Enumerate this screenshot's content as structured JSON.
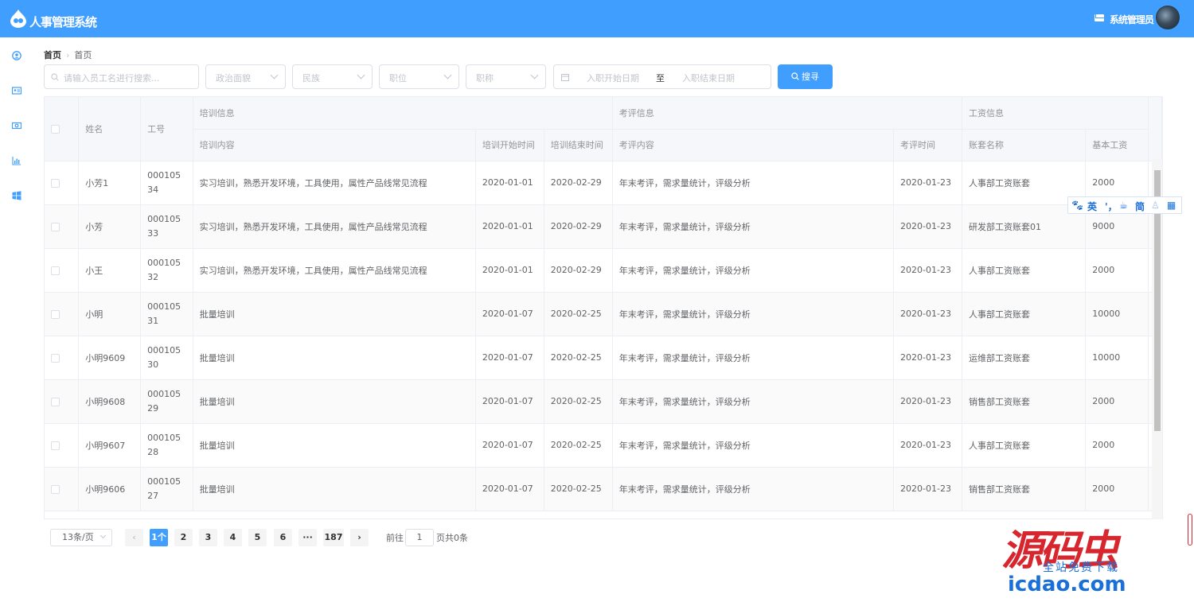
{
  "header": {
    "app_title": "人事管理系统",
    "admin_label": "系统管理员"
  },
  "sidebar": {
    "items": [
      {
        "icon": "user-circle-icon"
      },
      {
        "icon": "id-card-icon"
      },
      {
        "icon": "money-icon"
      },
      {
        "icon": "bar-chart-icon"
      },
      {
        "icon": "windows-icon"
      }
    ]
  },
  "breadcrumb": {
    "home": "首页",
    "current": "首页"
  },
  "filters": {
    "search_placeholder": "请输入员工名进行搜索...",
    "political": "政治面貌",
    "nation": "民族",
    "position": "职位",
    "title": "职称",
    "start_date": "入职开始日期",
    "to": "至",
    "end_date": "入职结束日期",
    "search_button": "搜寻"
  },
  "table": {
    "group_headers": {
      "training": "培训信息",
      "review": "考评信息",
      "salary": "工资信息"
    },
    "headers": {
      "name": "姓名",
      "work_id": "工号",
      "train_content": "培训内容",
      "train_start": "培训开始时间",
      "train_end": "培训结束时间",
      "review_content": "考评内容",
      "review_time": "考评时间",
      "account_name": "账套名称",
      "base_salary": "基本工资"
    },
    "rows": [
      {
        "name": "小芳1",
        "work_id": "00010534",
        "train_content": "实习培训，熟悉开发环境，工具使用，属性产品线常见流程",
        "train_start": "2020-01-01",
        "train_end": "2020-02-29",
        "review_content": "年末考评，需求量统计，评级分析",
        "review_time": "2020-01-23",
        "account_name": "人事部工资账套",
        "base_salary": "2000"
      },
      {
        "name": "小芳",
        "work_id": "00010533",
        "train_content": "实习培训，熟悉开发环境，工具使用，属性产品线常见流程",
        "train_start": "2020-01-01",
        "train_end": "2020-02-29",
        "review_content": "年末考评，需求量统计，评级分析",
        "review_time": "2020-01-23",
        "account_name": "研发部工资账套01",
        "base_salary": "9000"
      },
      {
        "name": "小王",
        "work_id": "00010532",
        "train_content": "实习培训，熟悉开发环境，工具使用，属性产品线常见流程",
        "train_start": "2020-01-01",
        "train_end": "2020-02-29",
        "review_content": "年末考评，需求量统计，评级分析",
        "review_time": "2020-01-23",
        "account_name": "人事部工资账套",
        "base_salary": "2000"
      },
      {
        "name": "小明",
        "work_id": "00010531",
        "train_content": "批量培训",
        "train_start": "2020-01-07",
        "train_end": "2020-02-25",
        "review_content": "年末考评，需求量统计，评级分析",
        "review_time": "2020-01-23",
        "account_name": "人事部工资账套",
        "base_salary": "10000"
      },
      {
        "name": "小明9609",
        "work_id": "00010530",
        "train_content": "批量培训",
        "train_start": "2020-01-07",
        "train_end": "2020-02-25",
        "review_content": "年末考评，需求量统计，评级分析",
        "review_time": "2020-01-23",
        "account_name": "运维部工资账套",
        "base_salary": "10000"
      },
      {
        "name": "小明9608",
        "work_id": "00010529",
        "train_content": "批量培训",
        "train_start": "2020-01-07",
        "train_end": "2020-02-25",
        "review_content": "年末考评，需求量统计，评级分析",
        "review_time": "2020-01-23",
        "account_name": "销售部工资账套",
        "base_salary": "2000"
      },
      {
        "name": "小明9607",
        "work_id": "00010528",
        "train_content": "批量培训",
        "train_start": "2020-01-07",
        "train_end": "2020-02-25",
        "review_content": "年末考评，需求量统计，评级分析",
        "review_time": "2020-01-23",
        "account_name": "人事部工资账套",
        "base_salary": "2000"
      },
      {
        "name": "小明9606",
        "work_id": "00010527",
        "train_content": "批量培训",
        "train_start": "2020-01-07",
        "train_end": "2020-02-25",
        "review_content": "年末考评，需求量统计，评级分析",
        "review_time": "2020-01-23",
        "account_name": "销售部工资账套",
        "base_salary": "2000"
      }
    ]
  },
  "pagination": {
    "page_size": "13条/页",
    "pages": [
      "1个",
      "2",
      "3",
      "4",
      "5",
      "6",
      "···",
      "187"
    ],
    "goto_label": "前往",
    "goto_value": "1",
    "total_label": "页共0条"
  },
  "ime_toolbar": {
    "lang": "英",
    "punct": "'，",
    "mode": "简"
  },
  "watermark": {
    "brand": "源码虫",
    "slogan": "全站免费下载",
    "domain": "icdao.com"
  }
}
